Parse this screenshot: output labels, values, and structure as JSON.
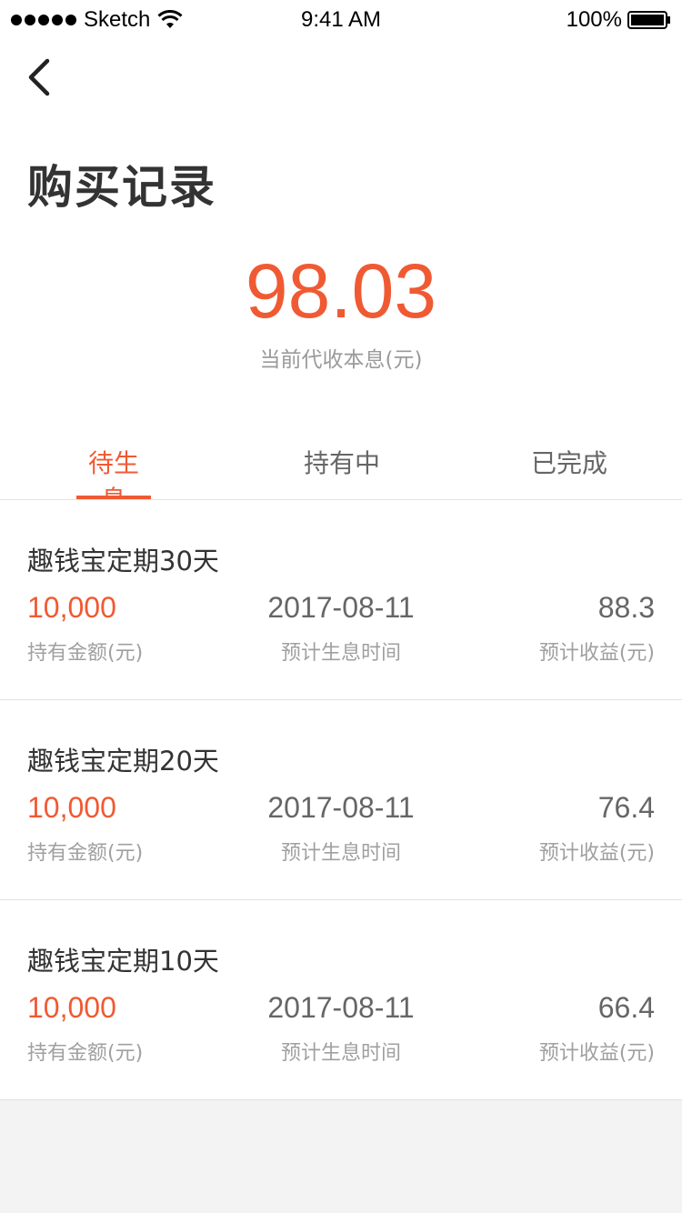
{
  "status_bar": {
    "carrier": "Sketch",
    "time": "9:41 AM",
    "battery": "100%"
  },
  "header": {
    "title": "购买记录"
  },
  "summary": {
    "amount": "98.03",
    "label": "当前代收本息(元)"
  },
  "tabs": [
    {
      "label": "待生息",
      "active": true
    },
    {
      "label": "持有中",
      "active": false
    },
    {
      "label": "已完成",
      "active": false
    }
  ],
  "records": [
    {
      "name": "趣钱宝定期30天",
      "amount": "10,000",
      "amount_label": "持有金额(元)",
      "date": "2017-08-11",
      "date_label": "预计生息时间",
      "income": "88.3",
      "income_label": "预计收益(元)"
    },
    {
      "name": "趣钱宝定期20天",
      "amount": "10,000",
      "amount_label": "持有金额(元)",
      "date": "2017-08-11",
      "date_label": "预计生息时间",
      "income": "76.4",
      "income_label": "预计收益(元)"
    },
    {
      "name": "趣钱宝定期10天",
      "amount": "10,000",
      "amount_label": "持有金额(元)",
      "date": "2017-08-11",
      "date_label": "预计生息时间",
      "income": "66.4",
      "income_label": "预计收益(元)"
    }
  ],
  "colors": {
    "accent": "#f05a33",
    "text_primary": "#333333",
    "text_secondary": "#666666",
    "text_muted": "#a0a0a0",
    "background": "#f3f3f3"
  },
  "icons": {
    "back": "chevron-left-icon",
    "wifi": "wifi-icon",
    "battery": "battery-icon",
    "signal": "signal-icon"
  }
}
